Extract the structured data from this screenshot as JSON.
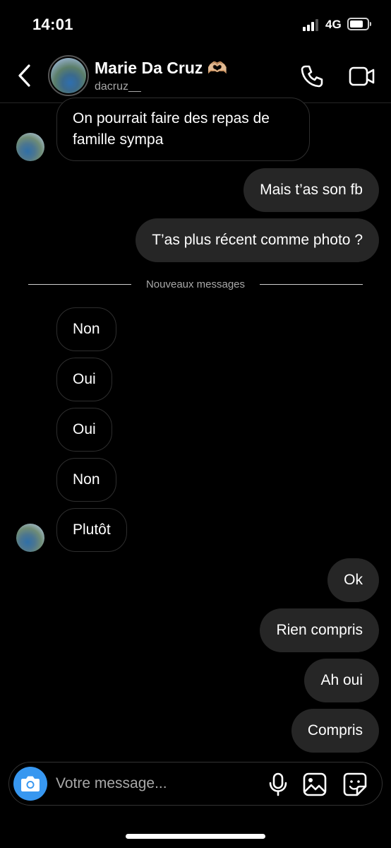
{
  "status_bar": {
    "time": "14:01",
    "network": "4G",
    "battery_level": 0.8
  },
  "header": {
    "contact_name": "Marie Da Cruz 🫶🏼",
    "username": "dacruz__",
    "avatar_icon": "profile-photo",
    "call_icon": "phone-icon",
    "video_icon": "video-camera-icon"
  },
  "messages": [
    {
      "direction": "in",
      "text": "On pourrait faire des repas de famille sympa"
    },
    {
      "direction": "out",
      "text": "Mais t’as son fb"
    },
    {
      "direction": "out",
      "text": "T’as plus récent comme photo ?"
    },
    {
      "direction": "in",
      "text": "Non"
    },
    {
      "direction": "in",
      "text": "Oui"
    },
    {
      "direction": "in",
      "text": "Oui"
    },
    {
      "direction": "in",
      "text": "Non"
    },
    {
      "direction": "in",
      "text": "Plutôt"
    },
    {
      "direction": "out",
      "text": "Ok"
    },
    {
      "direction": "out",
      "text": "Rien compris"
    },
    {
      "direction": "out",
      "text": "Ah oui"
    },
    {
      "direction": "out",
      "text": "Compris"
    }
  ],
  "divider_label": "Nouveaux messages",
  "composer": {
    "placeholder": "Votre message...",
    "icons": [
      "camera-icon",
      "microphone-icon",
      "gallery-icon",
      "sticker-icon"
    ]
  },
  "colors": {
    "background": "#000000",
    "outgoing_bubble": "#262626",
    "camera_button": "#3797f0",
    "secondary_text": "#a8a8a8"
  }
}
